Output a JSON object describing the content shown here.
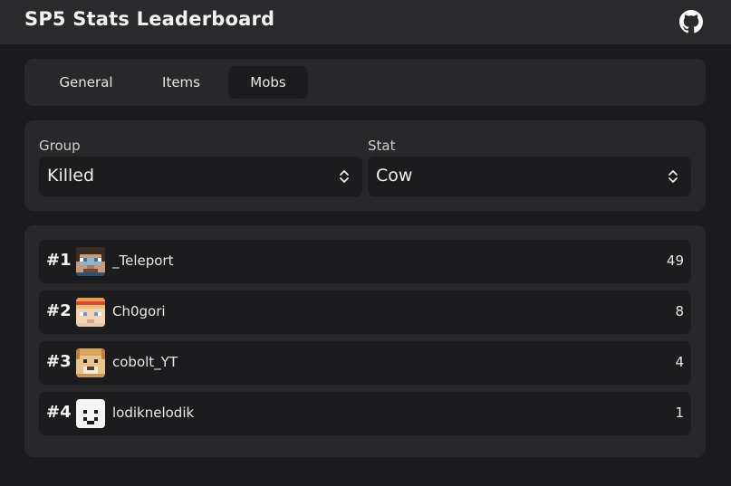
{
  "header": {
    "title": "SP5 Stats Leaderboard",
    "github_icon": "github-icon"
  },
  "tabs": [
    {
      "label": "General",
      "active": false
    },
    {
      "label": "Items",
      "active": false
    },
    {
      "label": "Mobs",
      "active": true
    }
  ],
  "filters": {
    "group": {
      "label": "Group",
      "value": "Killed"
    },
    "stat": {
      "label": "Stat",
      "value": "Cow"
    }
  },
  "leaderboard": [
    {
      "rank": "#1",
      "name": "_Teleport",
      "value": "49",
      "avatar": "teleport-skin-avatar"
    },
    {
      "rank": "#2",
      "name": "Ch0gori",
      "value": "8",
      "avatar": "ch0gori-skin-avatar"
    },
    {
      "rank": "#3",
      "name": "cobolt_YT",
      "value": "4",
      "avatar": "cobolt-skin-avatar"
    },
    {
      "rank": "#4",
      "name": "lodiknelodik",
      "value": "1",
      "avatar": "lodiknelodik-skin-avatar"
    }
  ],
  "colors": {
    "background": "#1b1b1d",
    "header": "#2a2a2d",
    "card": "#28282b",
    "inset": "#1c1c1e"
  }
}
